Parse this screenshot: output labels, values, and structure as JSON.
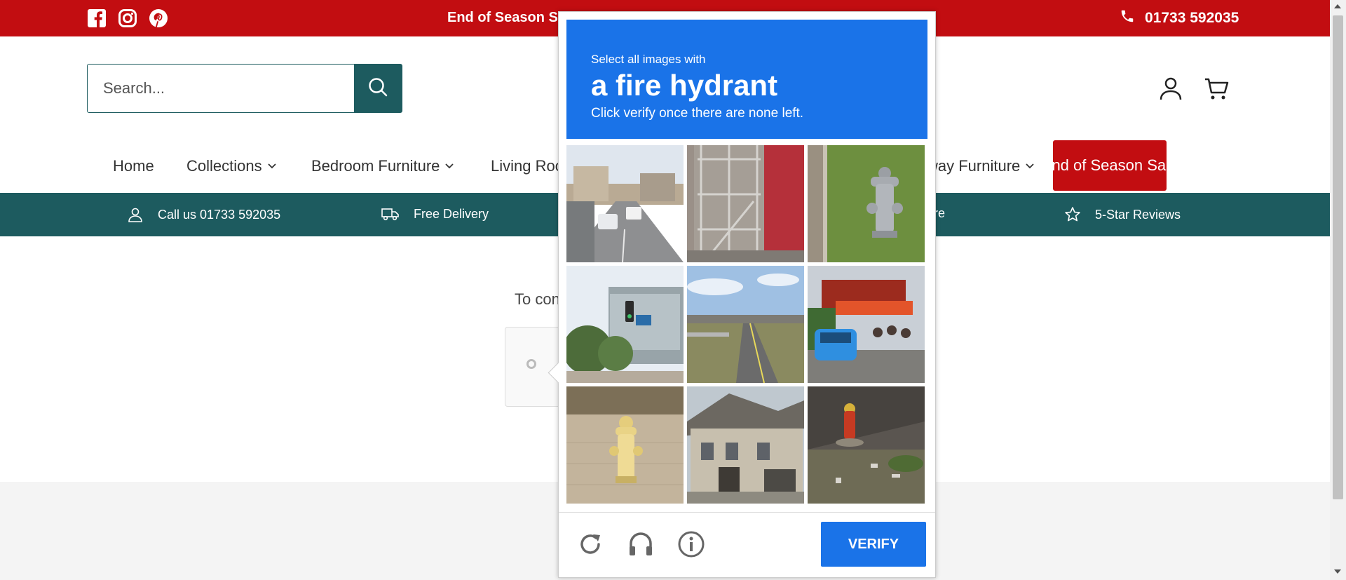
{
  "topbar": {
    "promo": "End of Season Sa",
    "phone": "01733 592035",
    "social": [
      "facebook-icon",
      "instagram-icon",
      "pinterest-icon"
    ]
  },
  "header": {
    "search_placeholder": "Search..."
  },
  "nav": {
    "items": [
      "Home",
      "Collections",
      "Bedroom Furniture",
      "Living Roo",
      "way Furniture"
    ],
    "sale": "End of Season Sale"
  },
  "trust": {
    "items": [
      "Call us 01733 592035",
      "Free Delivery",
      "ore",
      "5-Star Reviews"
    ]
  },
  "main": {
    "text": "To con"
  },
  "captcha": {
    "line1": "Select all images with",
    "target": "a fire hydrant",
    "line3": "Click verify once there are none left.",
    "verify": "VERIFY",
    "tiles": [
      "street with traffic",
      "metal stairs structure",
      "silver fire hydrant on grass",
      "buildings and traffic light",
      "highway overpass",
      "blue car on busy street",
      "yellow fire hydrant on pavement",
      "large house",
      "red fire hydrant in dirt"
    ]
  },
  "colors": {
    "brand_red": "#c20d11",
    "brand_teal": "#1d5b5f",
    "captcha_blue": "#1a73e8"
  }
}
